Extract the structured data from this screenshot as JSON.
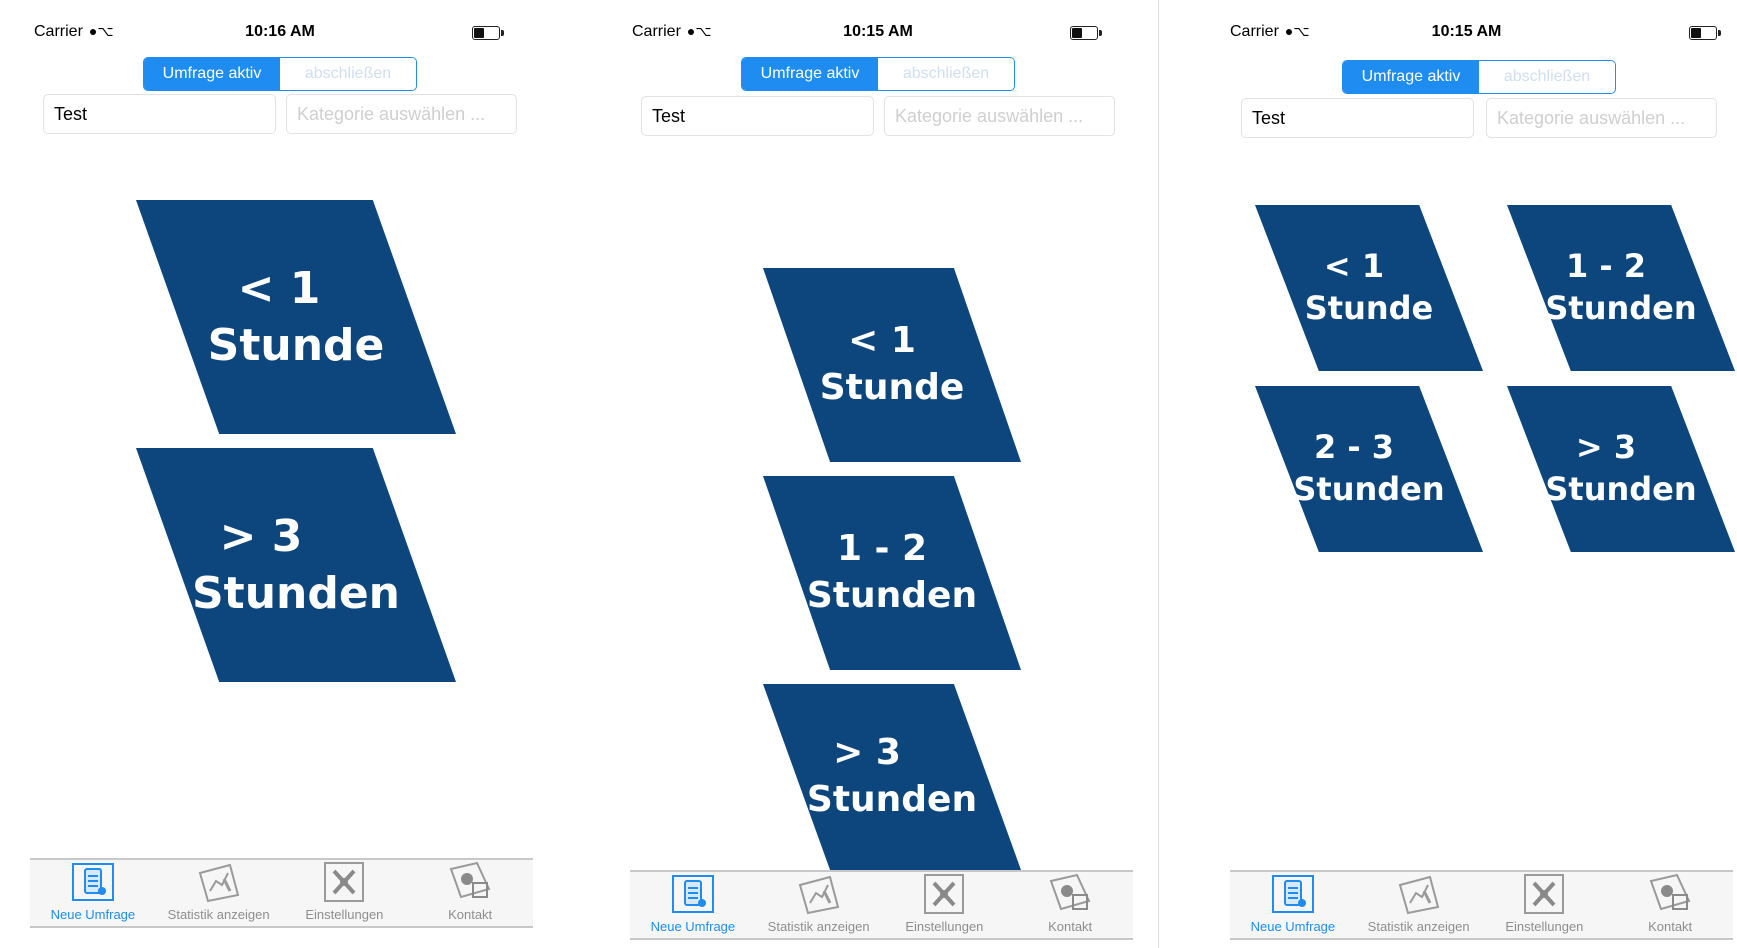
{
  "theme": {
    "accent": "#1e8cf0",
    "card_color": "#0c467c"
  },
  "screens": [
    {
      "status": {
        "carrier": "Carrier",
        "time": "10:16 AM"
      },
      "segment": {
        "active": "Umfrage aktiv",
        "inactive": "abschließen"
      },
      "name_field": {
        "value": "Test"
      },
      "category_field": {
        "placeholder": "Kategorie auswählen ..."
      },
      "cards": [
        {
          "line1": "< 1",
          "line2": "Stunde"
        },
        {
          "line1": "> 3",
          "line2": "Stunden"
        }
      ],
      "tabs": [
        {
          "label": "Neue Umfrage",
          "icon": "clipboard-icon"
        },
        {
          "label": "Statistik anzeigen",
          "icon": "chart-icon"
        },
        {
          "label": "Einstellungen",
          "icon": "tools-icon"
        },
        {
          "label": "Kontakt",
          "icon": "contact-icon"
        }
      ]
    },
    {
      "status": {
        "carrier": "Carrier",
        "time": "10:15 AM"
      },
      "segment": {
        "active": "Umfrage aktiv",
        "inactive": "abschließen"
      },
      "name_field": {
        "value": "Test"
      },
      "category_field": {
        "placeholder": "Kategorie auswählen ..."
      },
      "cards": [
        {
          "line1": "< 1",
          "line2": "Stunde"
        },
        {
          "line1": "1 - 2",
          "line2": "Stunden"
        },
        {
          "line1": "> 3",
          "line2": "Stunden"
        }
      ],
      "tabs": [
        {
          "label": "Neue Umfrage",
          "icon": "clipboard-icon"
        },
        {
          "label": "Statistik anzeigen",
          "icon": "chart-icon"
        },
        {
          "label": "Einstellungen",
          "icon": "tools-icon"
        },
        {
          "label": "Kontakt",
          "icon": "contact-icon"
        }
      ]
    },
    {
      "status": {
        "carrier": "Carrier",
        "time": "10:15 AM"
      },
      "segment": {
        "active": "Umfrage aktiv",
        "inactive": "abschließen"
      },
      "name_field": {
        "value": "Test"
      },
      "category_field": {
        "placeholder": "Kategorie auswählen ..."
      },
      "cards": [
        {
          "line1": "< 1",
          "line2": "Stunde"
        },
        {
          "line1": "1 - 2",
          "line2": "Stunden"
        },
        {
          "line1": "2 - 3",
          "line2": "Stunden"
        },
        {
          "line1": "> 3",
          "line2": "Stunden"
        }
      ],
      "tabs": [
        {
          "label": "Neue Umfrage",
          "icon": "clipboard-icon"
        },
        {
          "label": "Statistik anzeigen",
          "icon": "chart-icon"
        },
        {
          "label": "Einstellungen",
          "icon": "tools-icon"
        },
        {
          "label": "Kontakt",
          "icon": "contact-icon"
        }
      ]
    }
  ]
}
